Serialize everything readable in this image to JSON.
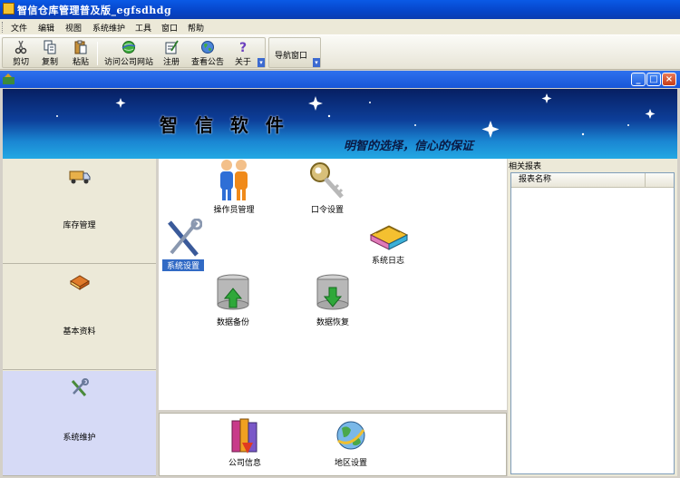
{
  "window": {
    "title": "智信仓库管理普及版_egfsdhdg"
  },
  "menu": {
    "items": [
      "文件",
      "编辑",
      "视图",
      "系统维护",
      "工具",
      "窗口",
      "帮助"
    ]
  },
  "toolbar": {
    "buttons": [
      {
        "label": "剪切",
        "icon": "scissors-icon"
      },
      {
        "label": "复制",
        "icon": "copy-icon"
      },
      {
        "label": "粘贴",
        "icon": "paste-icon"
      },
      {
        "label": "访问公司网站",
        "icon": "web-globe-icon"
      },
      {
        "label": "注册",
        "icon": "register-icon"
      },
      {
        "label": "查看公告",
        "icon": "announcement-globe-icon"
      },
      {
        "label": "关于",
        "icon": "help-question-icon"
      }
    ],
    "nav_window_label": "导航窗口"
  },
  "banner": {
    "brand": "智 信 软 件",
    "slogan": "明智的选择，信心的保证"
  },
  "left_nav": {
    "sections": [
      {
        "label": "库存管理",
        "icon": "truck-icon",
        "active": false
      },
      {
        "label": "基本资料",
        "icon": "book-icon",
        "active": false
      },
      {
        "label": "系统维护",
        "icon": "tools-icon",
        "active": true
      }
    ]
  },
  "main_icons": {
    "operator": "操作员管理",
    "password": "口令设置",
    "system_settings": "系统设置",
    "system_log": "系统日志",
    "backup": "数据备份",
    "restore": "数据恢复"
  },
  "bottom_icons": {
    "company_info": "公司信息",
    "region_settings": "地区设置"
  },
  "right_panel": {
    "title": "相关报表",
    "column_header": "报表名称"
  },
  "colors": {
    "titlebar": "#0a5ae6",
    "selection": "#316ac5",
    "active_nav": "#d6daf6"
  }
}
